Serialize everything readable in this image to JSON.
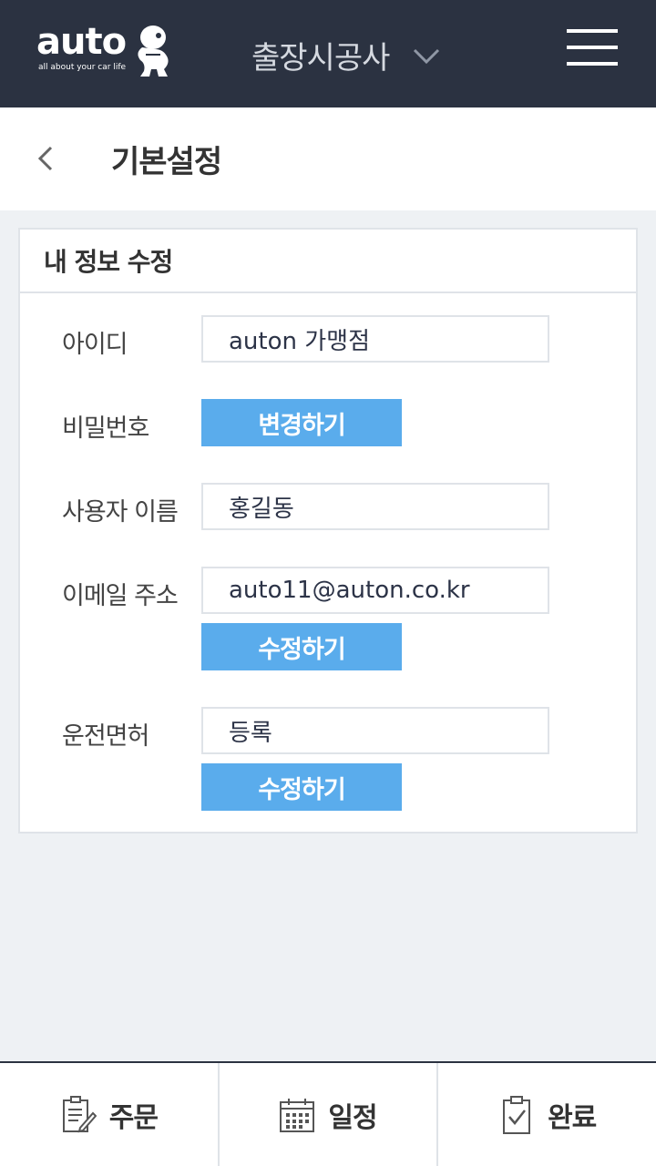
{
  "header": {
    "logo_text": "auto",
    "logo_tagline": "all about your car life",
    "store_name": "출장시공사"
  },
  "page": {
    "title": "기본설정"
  },
  "card": {
    "title": "내 정보 수정",
    "id_label": "아이디",
    "id_value": "auton 가맹점",
    "password_label": "비밀번호",
    "password_button": "변경하기",
    "username_label": "사용자 이름",
    "username_value": "홍길동",
    "email_label": "이메일 주소",
    "email_value": "auto11@auton.co.kr",
    "email_button": "수정하기",
    "license_label": "운전면허",
    "license_value": "등록",
    "license_button": "수정하기"
  },
  "bottom_nav": {
    "items": [
      {
        "label": "주문",
        "icon": "order-document-icon"
      },
      {
        "label": "일정",
        "icon": "calendar-icon"
      },
      {
        "label": "완료",
        "icon": "checklist-clipboard-icon"
      }
    ]
  },
  "colors": {
    "header_bg": "#2b3241",
    "button_blue": "#5aacec",
    "page_bg": "#eef1f4"
  }
}
